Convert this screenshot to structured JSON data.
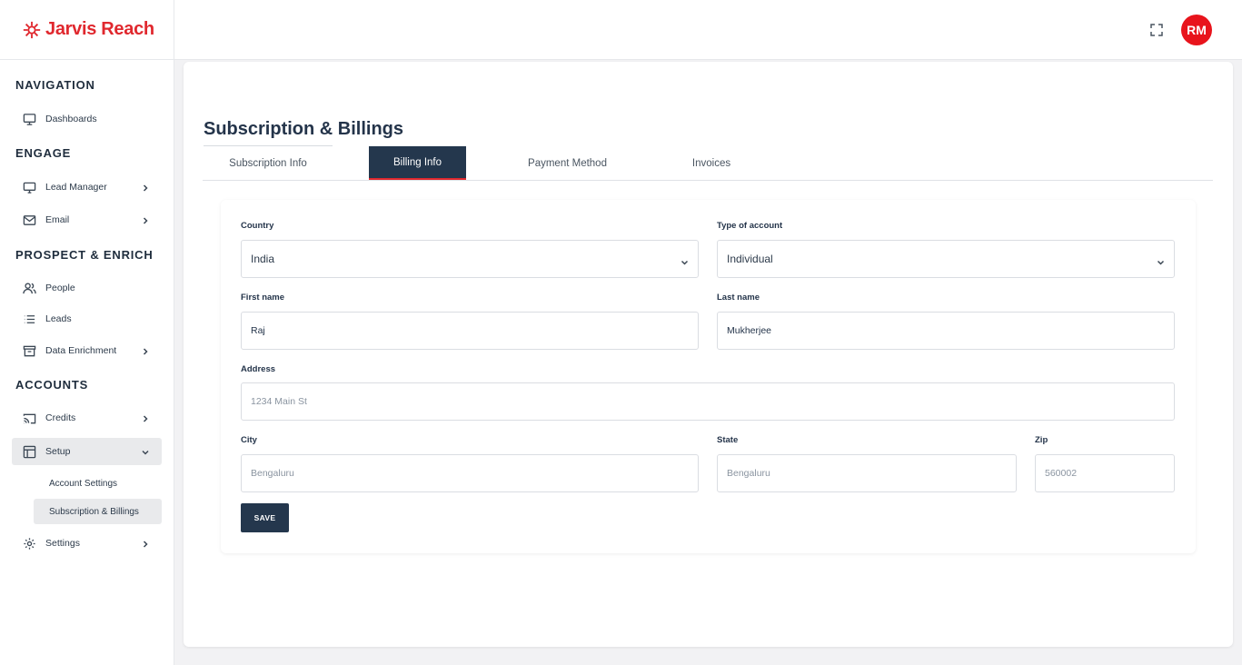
{
  "brand": {
    "name": "Jarvis Reach",
    "color": "#e0282e"
  },
  "sidebar": {
    "sections": [
      {
        "title": "NAVIGATION"
      },
      {
        "title": "ENGAGE"
      },
      {
        "title": "PROSPECT & ENRICH"
      },
      {
        "title": "ACCOUNTS"
      }
    ],
    "items": [
      {
        "label": "Dashboards",
        "icon": "monitor-icon"
      },
      {
        "label": "Lead Manager",
        "icon": "desktop-icon"
      },
      {
        "label": "Email",
        "icon": "mail-icon"
      },
      {
        "label": "People",
        "icon": "users-icon"
      },
      {
        "label": "Leads",
        "icon": "list-icon"
      },
      {
        "label": "Data Enrichment",
        "icon": "archive-icon"
      },
      {
        "label": "Credits",
        "icon": "cast-icon"
      },
      {
        "label": "Setup",
        "icon": "layout-icon"
      },
      {
        "label": "Settings",
        "icon": "gear-icon"
      }
    ],
    "setup_sub_items": [
      {
        "label": "Account Settings"
      },
      {
        "label": "Subscription & Billings"
      }
    ]
  },
  "header": {
    "avatar_initials": "RM",
    "avatar_color": "#e8141c"
  },
  "main": {
    "title": "Subscription & Billings",
    "tabs": [
      {
        "label": "Subscription Info"
      },
      {
        "label": "Billing Info"
      },
      {
        "label": "Payment Method"
      },
      {
        "label": "Invoices"
      }
    ],
    "active_tab": "Billing Info"
  },
  "form": {
    "country": {
      "label": "Country",
      "value": "India"
    },
    "account_type": {
      "label": "Type of account",
      "value": "Individual"
    },
    "first_name": {
      "label": "First name",
      "value": "Raj"
    },
    "last_name": {
      "label": "Last name",
      "value": "Mukherjee"
    },
    "address": {
      "label": "Address",
      "placeholder": "1234 Main St"
    },
    "city": {
      "label": "City",
      "placeholder": "Bengaluru"
    },
    "state": {
      "label": "State",
      "placeholder": "Bengaluru"
    },
    "zip": {
      "label": "Zip",
      "placeholder": "560002"
    },
    "save_label": "SAVE"
  }
}
